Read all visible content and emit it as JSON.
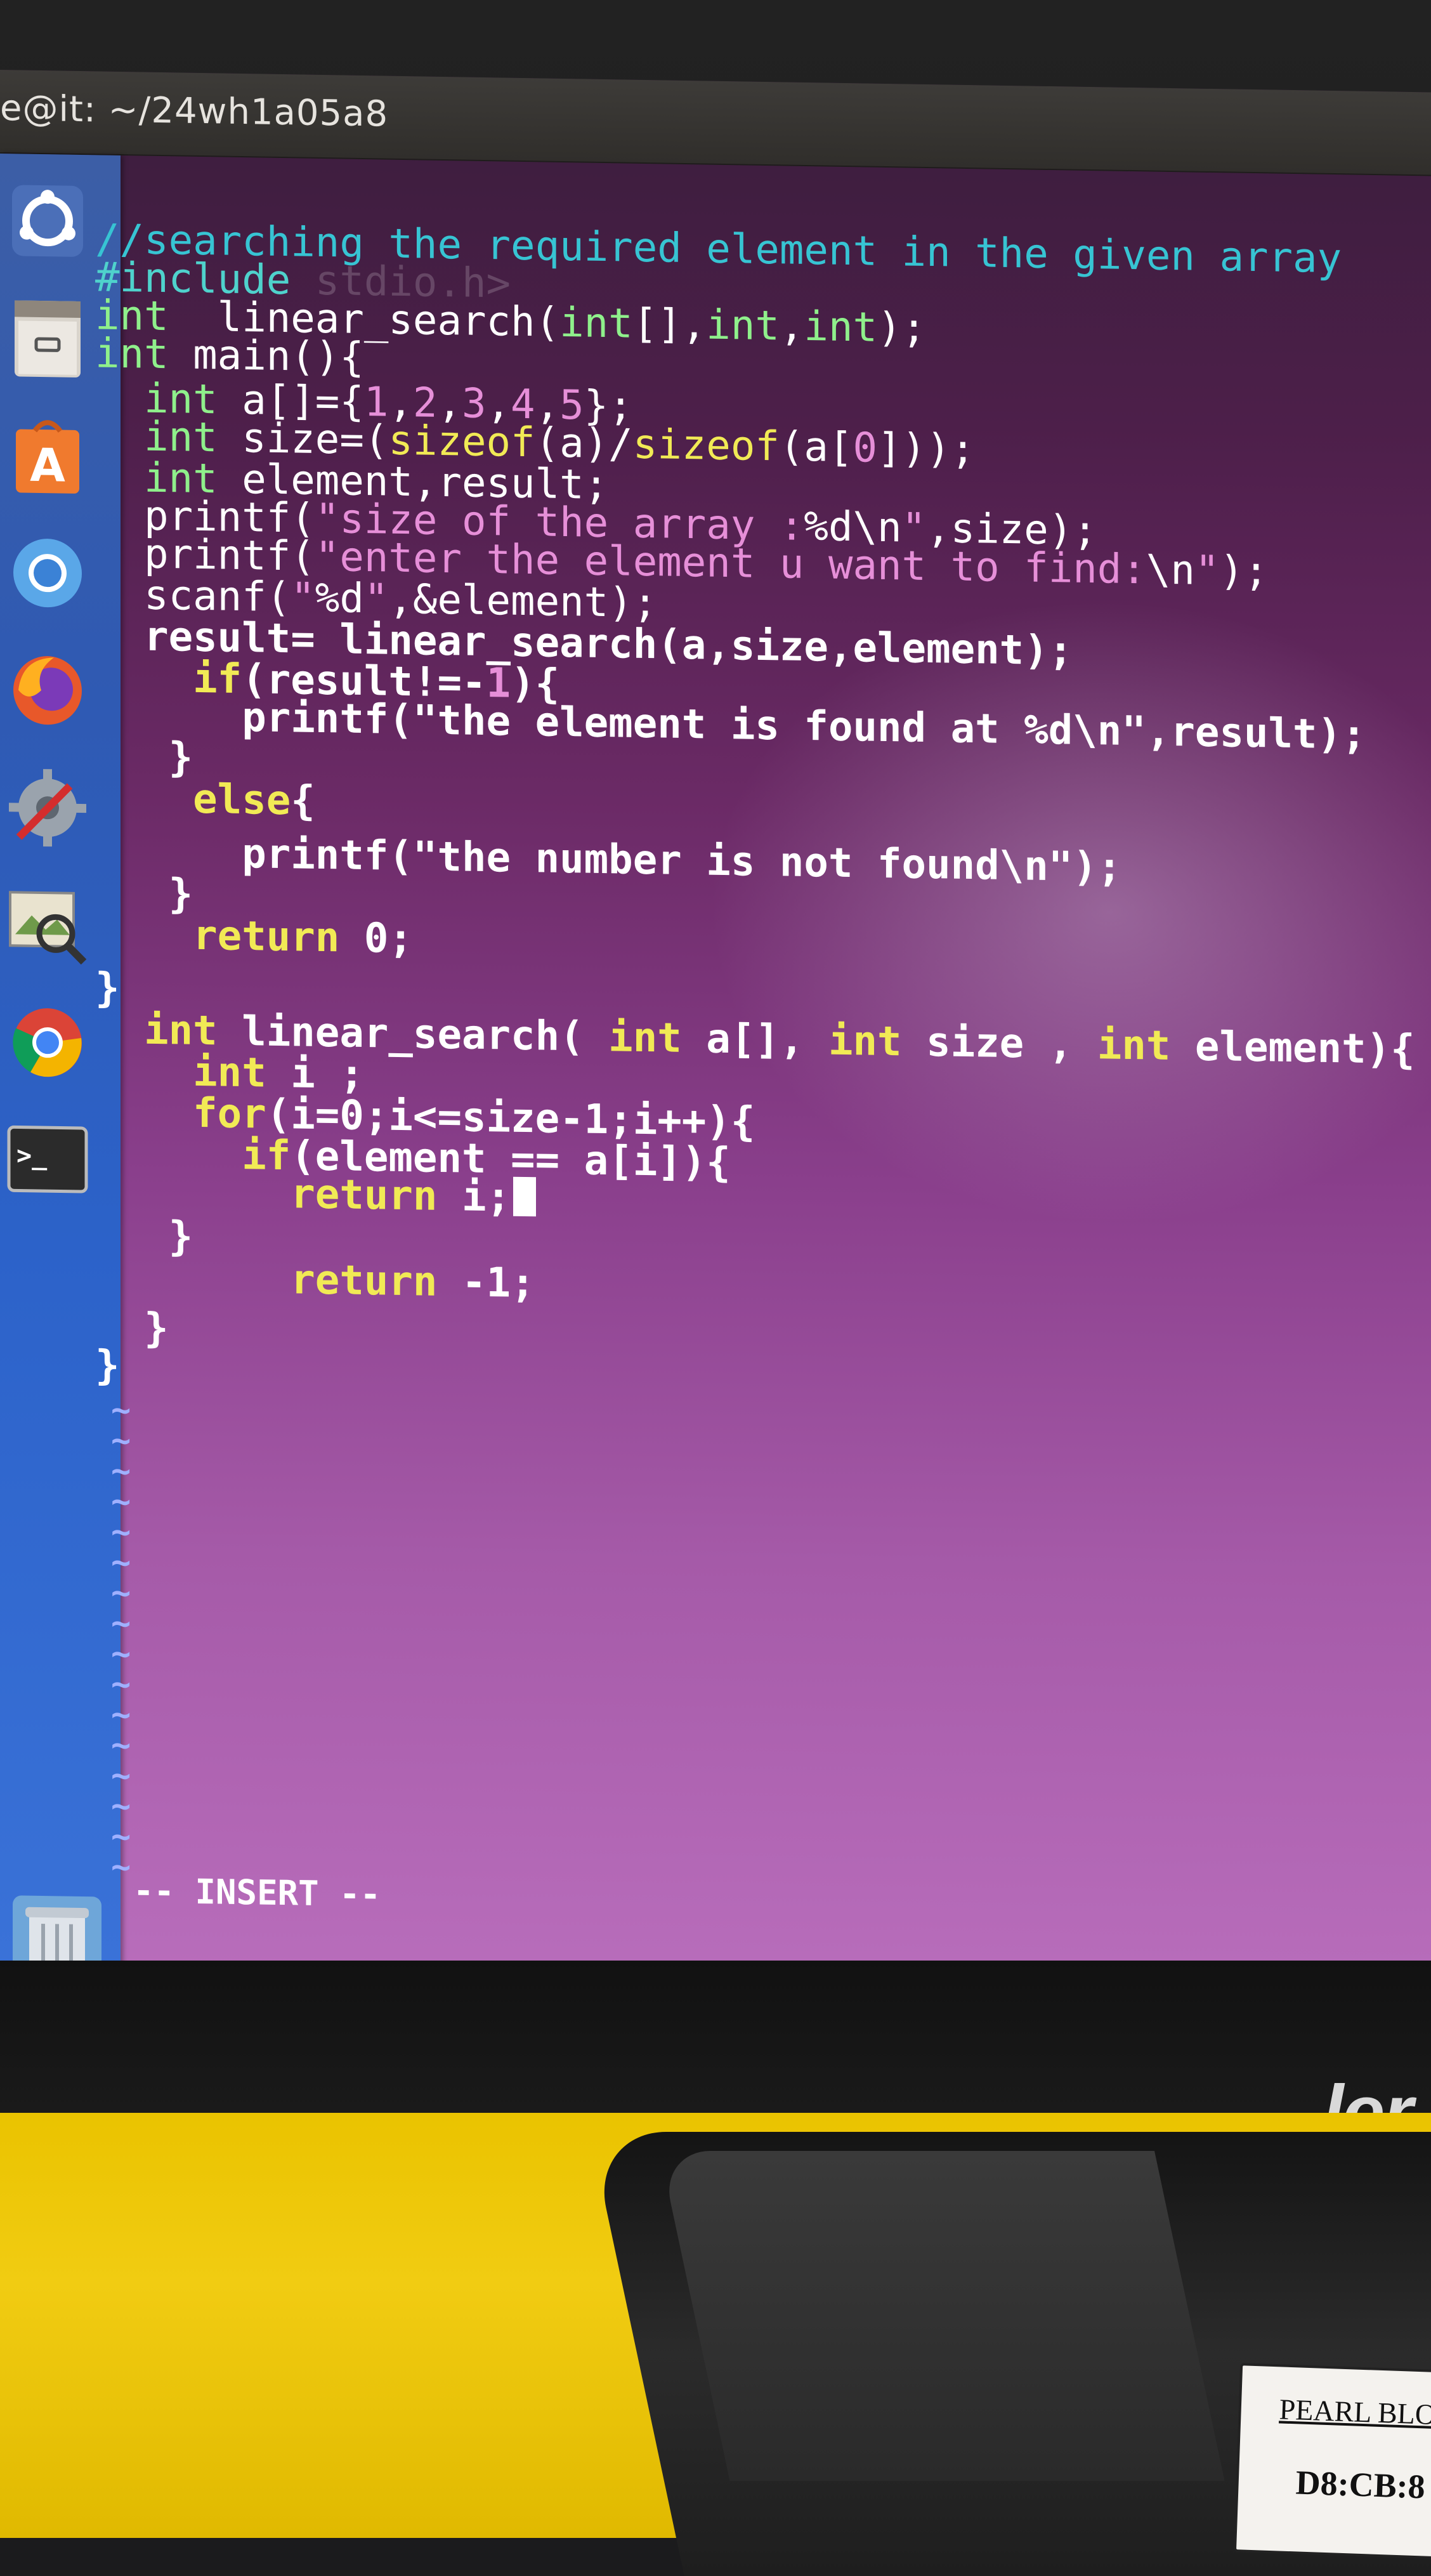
{
  "window": {
    "title": "e@it: ~/24wh1a05a8"
  },
  "launcher": {
    "items": [
      {
        "name": "ubuntu-dash-icon"
      },
      {
        "name": "files-icon"
      },
      {
        "name": "software-center-icon"
      },
      {
        "name": "chromium-icon"
      },
      {
        "name": "firefox-icon"
      },
      {
        "name": "system-settings-icon"
      },
      {
        "name": "image-viewer-icon"
      },
      {
        "name": "chrome-icon"
      },
      {
        "name": "terminal-icon"
      },
      {
        "name": "trash-icon"
      }
    ]
  },
  "editor": {
    "lines": [
      {
        "parts": [
          {
            "c": "cm",
            "t": "//searching the required element in the given array"
          }
        ]
      },
      {
        "parts": [
          {
            "c": "pp",
            "t": "#include "
          },
          {
            "c": "gh",
            "t": "stdio.h>"
          }
        ]
      },
      {
        "parts": [
          {
            "c": "ty",
            "t": "int"
          },
          {
            "c": "wt",
            "t": "  linear_search("
          },
          {
            "c": "ty",
            "t": "int"
          },
          {
            "c": "wt",
            "t": "[],"
          },
          {
            "c": "ty",
            "t": "int"
          },
          {
            "c": "wt",
            "t": ","
          },
          {
            "c": "ty",
            "t": "int"
          },
          {
            "c": "wt",
            "t": ");"
          }
        ]
      },
      {
        "parts": [
          {
            "c": "ty",
            "t": "int"
          },
          {
            "c": "wt",
            "t": " main(){"
          }
        ]
      },
      {
        "parts": [
          {
            "c": "wt",
            "t": "  "
          },
          {
            "c": "ty",
            "t": "int"
          },
          {
            "c": "wt",
            "t": " a[]={"
          },
          {
            "c": "nm",
            "t": "1"
          },
          {
            "c": "wt",
            "t": ","
          },
          {
            "c": "nm",
            "t": "2"
          },
          {
            "c": "wt",
            "t": ","
          },
          {
            "c": "nm",
            "t": "3"
          },
          {
            "c": "wt",
            "t": ","
          },
          {
            "c": "nm",
            "t": "4"
          },
          {
            "c": "wt",
            "t": ","
          },
          {
            "c": "nm",
            "t": "5"
          },
          {
            "c": "wt",
            "t": "};"
          }
        ]
      },
      {
        "parts": [
          {
            "c": "wt",
            "t": "  "
          },
          {
            "c": "ty",
            "t": "int"
          },
          {
            "c": "wt",
            "t": " size=("
          },
          {
            "c": "kw",
            "t": "sizeof"
          },
          {
            "c": "wt",
            "t": "(a)/"
          },
          {
            "c": "kw",
            "t": "sizeof"
          },
          {
            "c": "wt",
            "t": "(a["
          },
          {
            "c": "nm",
            "t": "0"
          },
          {
            "c": "wt",
            "t": "]));"
          }
        ]
      },
      {
        "parts": [
          {
            "c": "wt",
            "t": "  "
          },
          {
            "c": "ty",
            "t": "int"
          },
          {
            "c": "wt",
            "t": " element,result;"
          }
        ]
      },
      {
        "parts": [
          {
            "c": "wt",
            "t": "  printf("
          },
          {
            "c": "st",
            "t": "\"size of the array :"
          },
          {
            "c": "es",
            "t": "%d\\n"
          },
          {
            "c": "st",
            "t": "\""
          },
          {
            "c": "wt",
            "t": ",size);"
          }
        ]
      },
      {
        "parts": [
          {
            "c": "wt",
            "t": "  printf("
          },
          {
            "c": "st",
            "t": "\"enter the element u want to find:"
          },
          {
            "c": "es",
            "t": "\\n"
          },
          {
            "c": "st",
            "t": "\""
          },
          {
            "c": "wt",
            "t": ");"
          }
        ]
      },
      {
        "parts": [
          {
            "c": "wt",
            "t": "  scanf("
          },
          {
            "c": "st",
            "t": "\""
          },
          {
            "c": "es",
            "t": "%d"
          },
          {
            "c": "st",
            "t": "\""
          },
          {
            "c": "wt",
            "t": ",&element);"
          }
        ]
      },
      {
        "parts": [
          {
            "c": "wt",
            "t": "  result= linear_search(a,size,element);"
          }
        ]
      },
      {
        "parts": [
          {
            "c": "wt",
            "t": "    "
          },
          {
            "c": "kw",
            "t": "if"
          },
          {
            "c": "wt",
            "t": "(result!=-"
          },
          {
            "c": "nm",
            "t": "1"
          },
          {
            "c": "wt",
            "t": "){"
          }
        ]
      },
      {
        "parts": [
          {
            "c": "wt",
            "t": "      printf(\"the element is found at %d\\n\",result);"
          }
        ]
      },
      {
        "parts": [
          {
            "c": "wt",
            "t": "   }"
          }
        ]
      },
      {
        "parts": [
          {
            "c": "wt",
            "t": "    "
          },
          {
            "c": "kw",
            "t": "else"
          },
          {
            "c": "wt",
            "t": "{"
          }
        ]
      },
      {
        "parts": [
          {
            "c": "wt",
            "t": "      printf(\"the number is not found\\n\");"
          }
        ]
      },
      {
        "parts": [
          {
            "c": "wt",
            "t": "   }"
          }
        ]
      },
      {
        "parts": [
          {
            "c": "wt",
            "t": "    "
          },
          {
            "c": "kw",
            "t": "return"
          },
          {
            "c": "wt",
            "t": " 0;"
          }
        ]
      },
      {
        "parts": [
          {
            "c": "wt",
            "t": "}"
          }
        ]
      },
      {
        "parts": [
          {
            "c": "wt",
            "t": "  "
          },
          {
            "c": "kw",
            "t": "int"
          },
          {
            "c": "wt",
            "t": " linear_search( "
          },
          {
            "c": "kw",
            "t": "int"
          },
          {
            "c": "wt",
            "t": " a[], "
          },
          {
            "c": "kw",
            "t": "int"
          },
          {
            "c": "wt",
            "t": " size , "
          },
          {
            "c": "kw",
            "t": "int"
          },
          {
            "c": "wt",
            "t": " element){"
          }
        ]
      },
      {
        "parts": [
          {
            "c": "wt",
            "t": "    "
          },
          {
            "c": "kw",
            "t": "int"
          },
          {
            "c": "wt",
            "t": " i ;"
          }
        ]
      },
      {
        "parts": [
          {
            "c": "wt",
            "t": "    "
          },
          {
            "c": "kw",
            "t": "for"
          },
          {
            "c": "wt",
            "t": "(i=0;i<=size-1;i++){"
          }
        ]
      },
      {
        "parts": [
          {
            "c": "wt",
            "t": "      "
          },
          {
            "c": "kw",
            "t": "if"
          },
          {
            "c": "wt",
            "t": "(element == a[i]){"
          }
        ]
      },
      {
        "parts": [
          {
            "c": "wt",
            "t": "        "
          },
          {
            "c": "kw",
            "t": "return"
          },
          {
            "c": "wt",
            "t": " i;"
          }
        ],
        "cursor": true
      },
      {
        "parts": [
          {
            "c": "wt",
            "t": "   }"
          }
        ]
      },
      {
        "parts": [
          {
            "c": "wt",
            "t": "        "
          },
          {
            "c": "kw",
            "t": "return"
          },
          {
            "c": "wt",
            "t": " -1;"
          }
        ]
      },
      {
        "parts": [
          {
            "c": "wt",
            "t": "  }"
          }
        ]
      },
      {
        "parts": [
          {
            "c": "wt",
            "t": "}"
          }
        ]
      }
    ],
    "tilde": "~",
    "mode": "-- INSERT --"
  },
  "hardware": {
    "brand": "ler",
    "sticker_line1": "PEARL BLO",
    "sticker_line2": "D8:CB:8"
  }
}
